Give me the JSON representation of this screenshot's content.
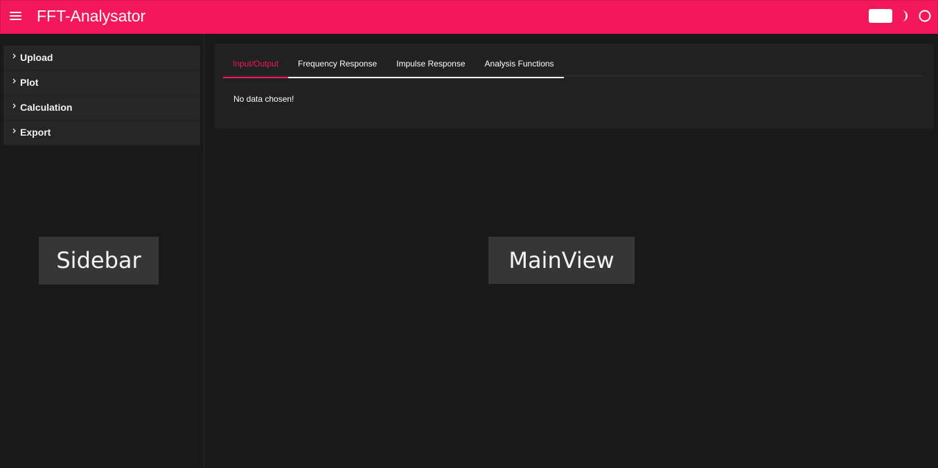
{
  "header": {
    "title": "FFT-Analysator",
    "menu_icon": "hamburger-menu-icon",
    "toggle_icon": "light-mode-toggle-icon",
    "theme_icon": "moon-icon",
    "status_icon": "circle-icon",
    "color": "#f2185b"
  },
  "sidebar": {
    "items": [
      {
        "label": "Upload"
      },
      {
        "label": "Plot"
      },
      {
        "label": "Calculation"
      },
      {
        "label": "Export"
      }
    ],
    "overlay_label": "Sidebar"
  },
  "main": {
    "tabs": [
      {
        "label": "Input/Output",
        "active": true
      },
      {
        "label": "Frequency Response",
        "active": false
      },
      {
        "label": "Impulse Response",
        "active": false
      },
      {
        "label": "Analysis Functions",
        "active": false
      }
    ],
    "message": "No data chosen!",
    "overlay_label": "MainView"
  }
}
